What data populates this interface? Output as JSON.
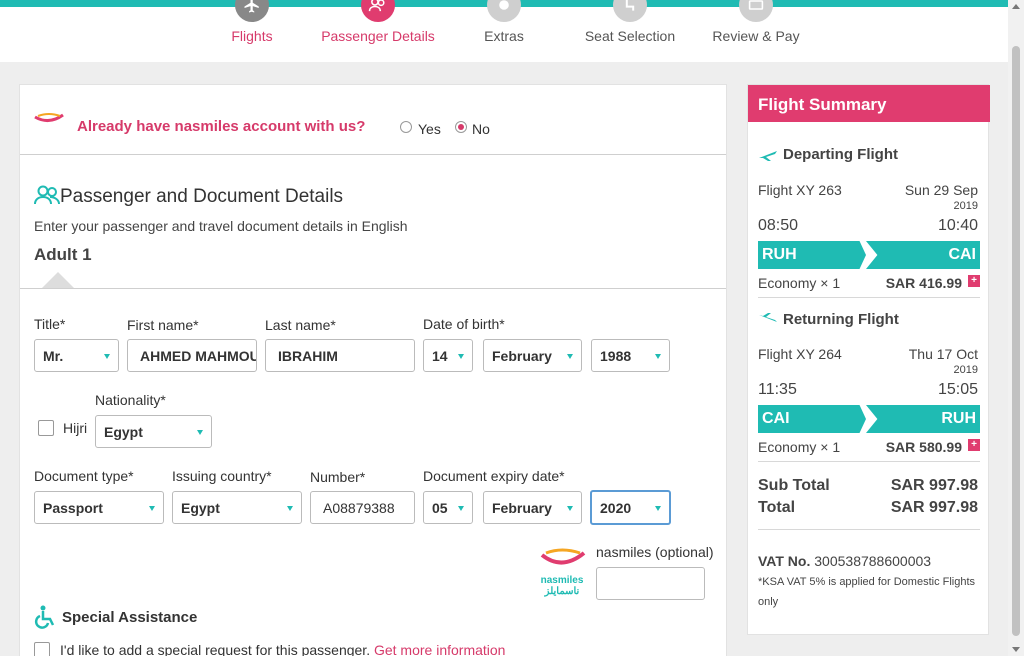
{
  "steps": [
    {
      "label": "Flights",
      "state": "done",
      "icon": "plane-icon"
    },
    {
      "label": "Passenger Details",
      "state": "active",
      "icon": "people-icon"
    },
    {
      "label": "Extras",
      "state": "future",
      "icon": "meal-icon"
    },
    {
      "label": "Seat Selection",
      "state": "future",
      "icon": "seat-icon"
    },
    {
      "label": "Review & Pay",
      "state": "future",
      "icon": "payment-icon"
    }
  ],
  "account": {
    "question": "Already have nasmiles account with us?",
    "yes": "Yes",
    "no": "No",
    "selected": "No"
  },
  "passenger": {
    "section_title": "Passenger and Document Details",
    "subtitle": "Enter your passenger and travel document details in English",
    "adult_title": "Adult 1",
    "title_label": "Title*",
    "title_value": "Mr.",
    "first_name_label": "First name*",
    "first_name_value": "AHMED MAHMOUD",
    "last_name_label": "Last name*",
    "last_name_value": "IBRAHIM",
    "dob_label": "Date of birth*",
    "dob_day": "14",
    "dob_month": "February",
    "dob_year": "1988",
    "hijri_label": "Hijri",
    "nationality_label": "Nationality*",
    "nationality_value": "Egypt",
    "doc_type_label": "Document type*",
    "doc_type_value": "Passport",
    "issuing_label": "Issuing country*",
    "issuing_value": "Egypt",
    "number_label": "Number*",
    "number_value": "A08879388",
    "expiry_label": "Document expiry date*",
    "expiry_day": "05",
    "expiry_month": "February",
    "expiry_year": "2020",
    "nasmiles_label": "nasmiles (optional)",
    "nasmiles_value": "",
    "nasmiles_logo_text": "nasmiles",
    "nasmiles_logo_arabic": "ناسمايلز",
    "special_title": "Special Assistance",
    "special_text": "I'd like to add a special request for this passenger.",
    "special_link": "Get more information"
  },
  "summary": {
    "title": "Flight Summary",
    "departing": {
      "heading": "Departing Flight",
      "flight": "Flight XY 263",
      "date": "Sun 29 Sep",
      "year": "2019",
      "dep_time": "08:50",
      "arr_time": "10:40",
      "from": "RUH",
      "to": "CAI",
      "cabin": "Economy × 1",
      "price": "SAR 416.99"
    },
    "returning": {
      "heading": "Returning Flight",
      "flight": "Flight XY 264",
      "date": "Thu 17 Oct",
      "year": "2019",
      "dep_time": "11:35",
      "arr_time": "15:05",
      "from": "CAI",
      "to": "RUH",
      "cabin": "Economy × 1",
      "price": "SAR 580.99"
    },
    "sub_total_label": "Sub Total",
    "sub_total_value": "SAR 997.98",
    "total_label": "Total",
    "total_value": "SAR 997.98",
    "vat_label": "VAT No.",
    "vat_number": "300538788600003",
    "vat_note": "*KSA VAT 5% is applied for Domestic Flights only"
  },
  "colors": {
    "accent_pink": "#e03c6f",
    "teal": "#1fbbb3"
  }
}
